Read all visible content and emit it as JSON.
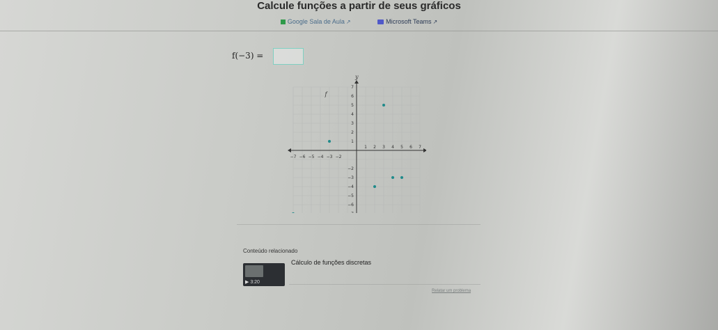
{
  "header": {
    "title": "Calcule funções a partir de seus gráficos",
    "link_classroom": "Google Sala de Aula",
    "link_teams": "Microsoft Teams",
    "ext_glyph": "↗"
  },
  "question": {
    "expression": "f(−3) =",
    "answer_value": ""
  },
  "graph": {
    "x_axis_label": "x",
    "y_axis_label": "y",
    "function_label": "f",
    "x_ticks": [
      "−7",
      "−6",
      "−5",
      "−4",
      "−3",
      "−2",
      "1",
      "2",
      "3",
      "4",
      "5",
      "6",
      "7"
    ],
    "y_ticks": [
      "7",
      "6",
      "5",
      "4",
      "3",
      "2",
      "1",
      "−2",
      "−3",
      "−4",
      "−5",
      "−6",
      "−7"
    ],
    "point_color": "#1f8a8a"
  },
  "chart_data": {
    "type": "scatter",
    "title": "",
    "xlabel": "x",
    "ylabel": "y",
    "xlim": [
      -7,
      7
    ],
    "ylim": [
      -7,
      7
    ],
    "grid": true,
    "series": [
      {
        "name": "f",
        "x": [
          -7,
          -3,
          2,
          3,
          5,
          4
        ],
        "y": [
          -7,
          1,
          -4,
          5,
          -3,
          -3
        ]
      }
    ]
  },
  "related": {
    "heading": "Conteúdo relacionado",
    "video_title": "Cálculo de funções discretas",
    "video_duration": "3:20",
    "report_link": "Relatar um problema"
  }
}
